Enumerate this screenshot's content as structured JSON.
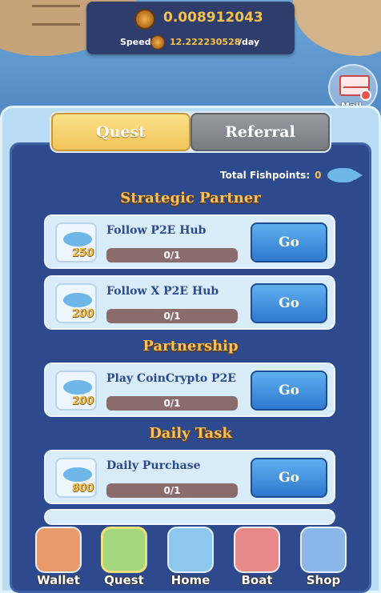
{
  "stats": {
    "balance": "0.008912043",
    "speed_label": "Speed:",
    "speed_value": "12.222230528",
    "speed_unit": "/day"
  },
  "mail": {
    "label": "Mail"
  },
  "tabs": [
    {
      "label": "Quest",
      "active": true
    },
    {
      "label": "Referral",
      "active": false
    }
  ],
  "fishpoints": {
    "label": "Total Fishpoints:",
    "value": "0"
  },
  "sections": [
    {
      "title": "Strategic Partner",
      "tasks": [
        {
          "name": "Follow P2E Hub",
          "reward": "250",
          "progress": "0/1",
          "button": "Go"
        },
        {
          "name": "Follow X P2E Hub",
          "reward": "200",
          "progress": "0/1",
          "button": "Go"
        }
      ]
    },
    {
      "title": "Partnership",
      "tasks": [
        {
          "name": "Play CoinCrypto P2E",
          "reward": "200",
          "progress": "0/1",
          "button": "Go"
        }
      ]
    },
    {
      "title": "Daily Task",
      "tasks": [
        {
          "name": "Daily Purchase",
          "reward": "800",
          "progress": "0/1",
          "button": "Go"
        }
      ]
    }
  ],
  "nav": [
    {
      "label": "Wallet",
      "icon": "wallet-icon",
      "color": "#e99a6a"
    },
    {
      "label": "Quest",
      "icon": "quest-clipboard-icon",
      "color": "#a5d77e"
    },
    {
      "label": "Home",
      "icon": "boat-home-icon",
      "color": "#8cc7ee"
    },
    {
      "label": "Boat",
      "icon": "cards-icon",
      "color": "#e98a8a"
    },
    {
      "label": "Shop",
      "icon": "treasure-chest-icon",
      "color": "#8ab7e8"
    }
  ]
}
